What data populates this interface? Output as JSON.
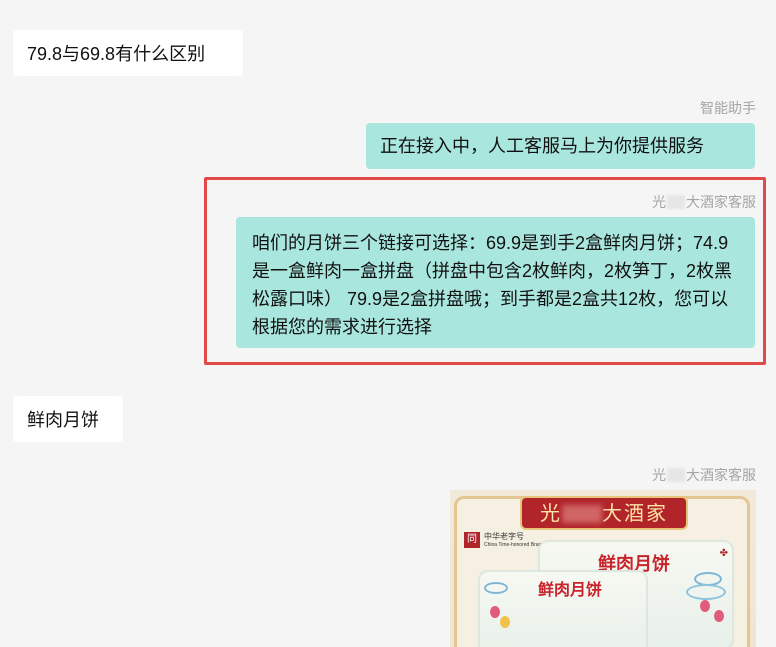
{
  "messages": {
    "user_q1": "79.8与69.8有什么区别",
    "assistant_label": "智能助手",
    "assistant_msg": "正在接入中，人工客服马上为你提供服务",
    "agent_label_prefix": "光",
    "agent_label_suffix": "大酒家客服",
    "agent_msg": "咱们的月饼三个链接可选择：69.9是到手2盒鲜肉月饼；74.9是一盒鲜肉一盒拼盘（拼盘中包含2枚鲜肉，2枚笋丁，2枚黑松露口味）  79.9是2盒拼盘哦；到手都是2盒共12枚，您可以根据您的需求进行选择",
    "user_q2": "鲜肉月饼",
    "agent_label2_prefix": "光",
    "agent_label2_suffix": "大酒家客服"
  },
  "image": {
    "banner_prefix": "光",
    "banner_suffix": "大酒家",
    "logo_mark": "同",
    "logo_text": "中华老字号",
    "logo_subtext": "China Time-honored Brand",
    "box1_title": "鲜肉月饼",
    "box2_title": "鲜肉月饼"
  },
  "colors": {
    "background": "#f5f5f5",
    "left_bubble": "#ffffff",
    "right_bubble": "#a9e6dd",
    "highlight_border": "#e24a4a",
    "label_text": "#a5a5a5"
  }
}
